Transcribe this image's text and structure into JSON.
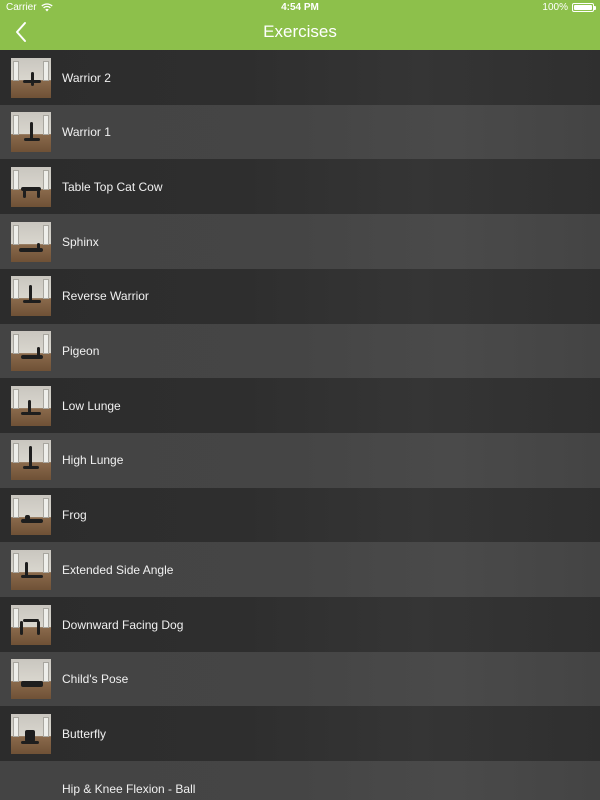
{
  "status_bar": {
    "carrier": "Carrier",
    "time": "4:54 PM",
    "battery": "100%",
    "battery_level": 1.0
  },
  "nav": {
    "title": "Exercises",
    "back_icon": "chevron-left-icon"
  },
  "colors": {
    "header": "#8dc04b",
    "row_dark": "#2e2e2e",
    "row_light": "#454545",
    "text": "#f0f0f0"
  },
  "exercises": [
    {
      "label": "Warrior 2",
      "has_thumbnail": true
    },
    {
      "label": "Warrior 1",
      "has_thumbnail": true
    },
    {
      "label": "Table Top Cat Cow",
      "has_thumbnail": true
    },
    {
      "label": "Sphinx",
      "has_thumbnail": true
    },
    {
      "label": "Reverse Warrior",
      "has_thumbnail": true
    },
    {
      "label": "Pigeon",
      "has_thumbnail": true
    },
    {
      "label": "Low Lunge",
      "has_thumbnail": true
    },
    {
      "label": "High Lunge",
      "has_thumbnail": true
    },
    {
      "label": "Frog",
      "has_thumbnail": true
    },
    {
      "label": "Extended Side Angle",
      "has_thumbnail": true
    },
    {
      "label": "Downward Facing Dog",
      "has_thumbnail": true
    },
    {
      "label": "Child's Pose",
      "has_thumbnail": true
    },
    {
      "label": "Butterfly",
      "has_thumbnail": true
    },
    {
      "label": "Hip & Knee Flexion - Ball",
      "has_thumbnail": false
    }
  ]
}
